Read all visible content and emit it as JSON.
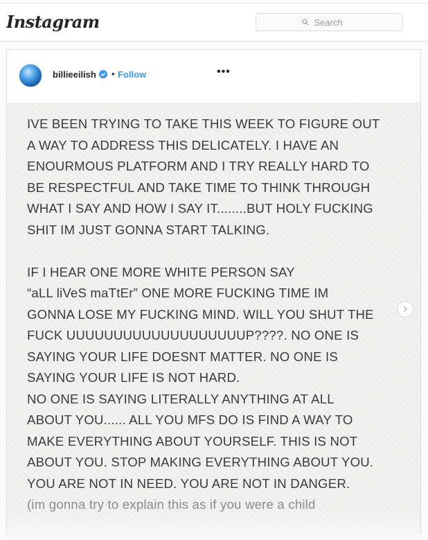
{
  "header": {
    "logo": "Instagram",
    "search_placeholder": "Search"
  },
  "post": {
    "username": "billieeilish",
    "separator": "•",
    "follow_label": "Follow",
    "more_label": "•••",
    "verified": true,
    "text_lines": [
      "IVE BEEN TRYING TO TAKE THIS WEEK TO FIGURE OUT",
      "A WAY TO ADDRESS THIS DELICATELY. I HAVE AN",
      "ENOURMOUS PLATFORM AND I TRY REALLY HARD TO",
      "BE RESPECTFUL AND TAKE TIME TO THINK THROUGH",
      "WHAT I SAY AND HOW I SAY IT........BUT HOLY FUCKING",
      "SHIT IM JUST GONNA START TALKING.",
      "",
      "IF I HEAR ONE MORE WHITE PERSON SAY",
      "“aLL liVeS maTtEr” ONE MORE FUCKING TIME IM",
      "GONNA LOSE MY FUCKING MIND. WILL YOU SHUT THE",
      "FUCK UUUUUUUUUUUUUUUUUUUP????. NO ONE IS",
      "SAYING YOUR LIFE DOESNT MATTER. NO ONE IS",
      "SAYING YOUR LIFE IS NOT HARD.",
      "NO ONE IS SAYING LITERALLY ANYTHING AT ALL",
      "ABOUT YOU...... ALL YOU MFS DO IS FIND A WAY TO",
      "MAKE EVERYTHING ABOUT YOURSELF. THIS IS NOT",
      "ABOUT YOU. STOP MAKING EVERYTHING ABOUT YOU.",
      "YOU ARE NOT IN NEED. YOU ARE NOT IN DANGER.",
      "(im gonna try to explain this as if you were a child"
    ]
  },
  "colors": {
    "follow": "#3897f0",
    "verified": "#3897f0",
    "text": "#3a3a3a",
    "border": "#dbdbdb"
  },
  "icons": {
    "search": "search-icon",
    "verified": "verified-badge-icon",
    "next": "chevron-right-icon"
  }
}
